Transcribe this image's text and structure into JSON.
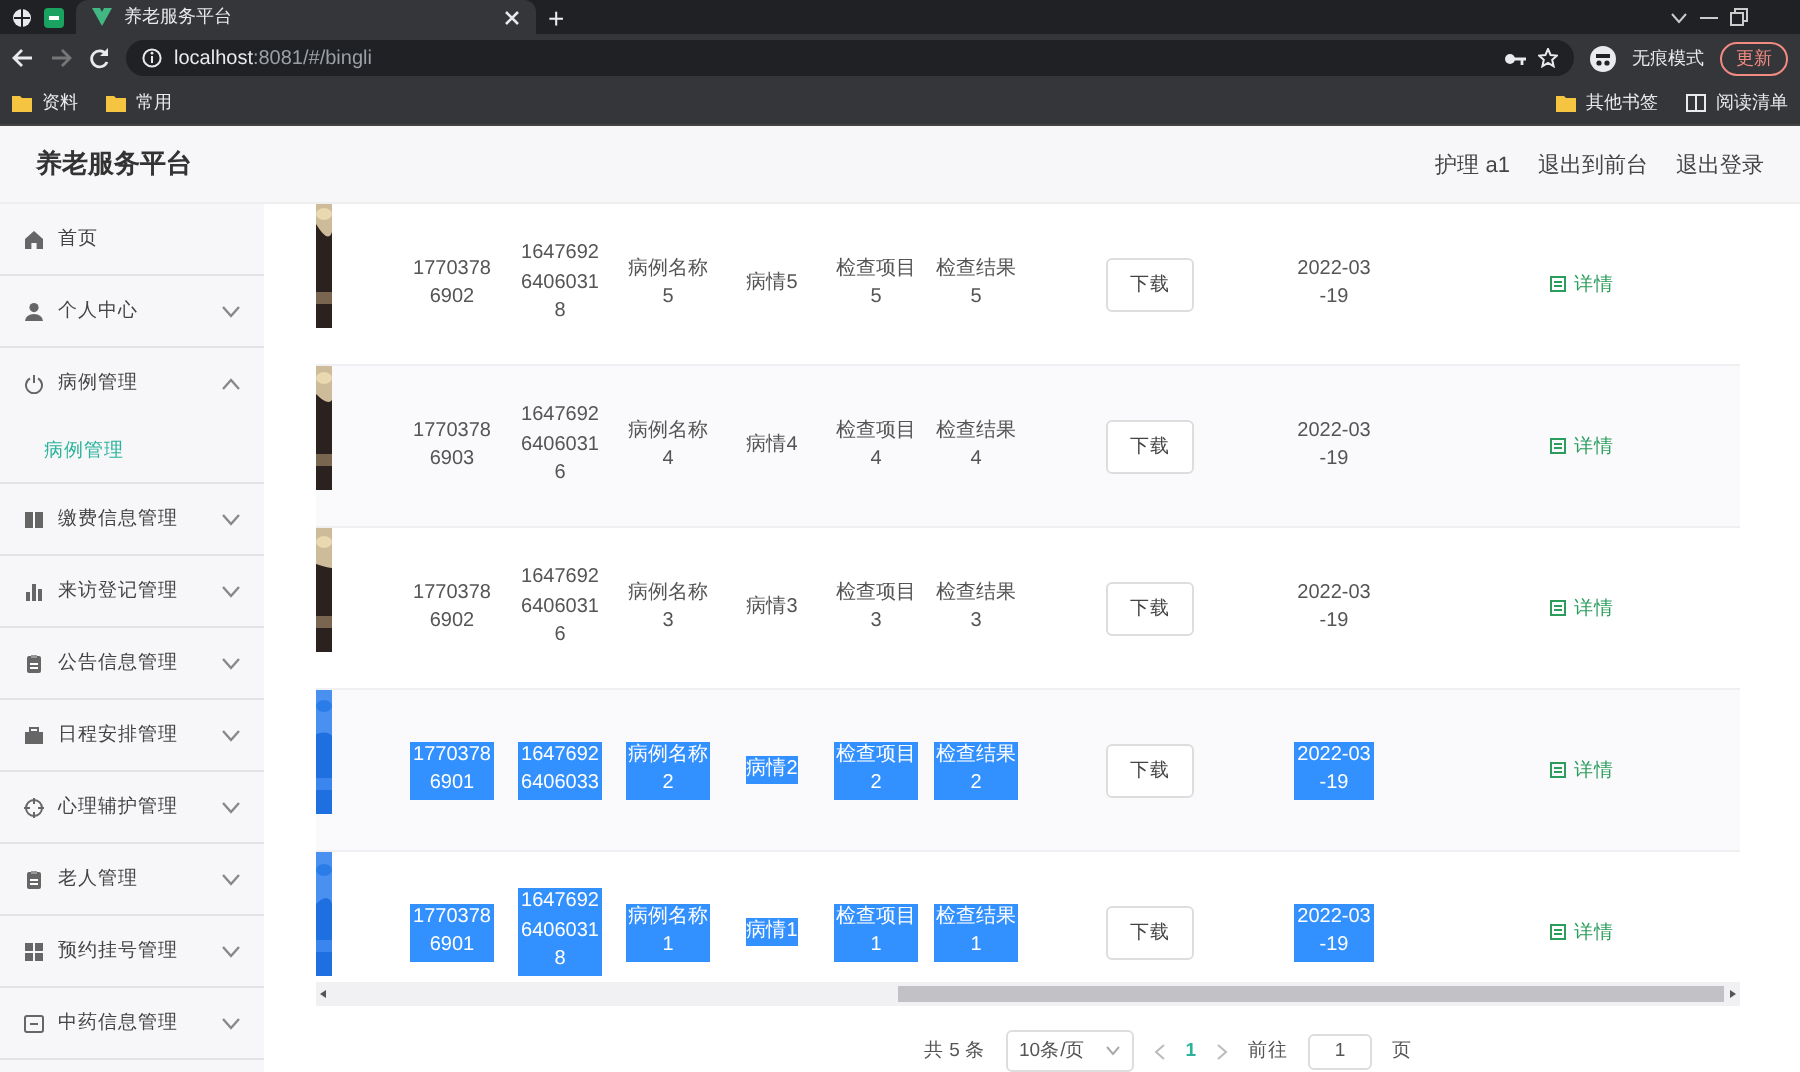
{
  "browser": {
    "tab_title": "养老服务平台",
    "new_tab": "+",
    "url_host": "localhost",
    "url_path": ":8081/#/bingli",
    "incognito": "无痕模式",
    "update": "更新",
    "bookmarks": [
      {
        "label": "资料"
      },
      {
        "label": "常用"
      }
    ],
    "bookmarks_right": [
      {
        "label": "其他书签",
        "kind": "folder"
      },
      {
        "label": "阅读清单",
        "kind": "list"
      }
    ]
  },
  "header": {
    "title": "养老服务平台",
    "links": [
      "护理 a1",
      "退出到前台",
      "退出登录"
    ]
  },
  "sidebar": {
    "items": [
      {
        "label": "首页",
        "kind": "link"
      },
      {
        "label": "个人中心",
        "kind": "menu",
        "expanded": false
      },
      {
        "label": "病例管理",
        "kind": "menu",
        "expanded": true,
        "children": [
          {
            "label": "病例管理",
            "selected": true
          }
        ]
      },
      {
        "label": "缴费信息管理",
        "kind": "menu",
        "expanded": false
      },
      {
        "label": "来访登记管理",
        "kind": "menu",
        "expanded": false
      },
      {
        "label": "公告信息管理",
        "kind": "menu",
        "expanded": false
      },
      {
        "label": "日程安排管理",
        "kind": "menu",
        "expanded": false
      },
      {
        "label": "心理辅护管理",
        "kind": "menu",
        "expanded": false
      },
      {
        "label": "老人管理",
        "kind": "menu",
        "expanded": false
      },
      {
        "label": "预约挂号管理",
        "kind": "menu",
        "expanded": false
      },
      {
        "label": "中药信息管理",
        "kind": "menu",
        "expanded": false
      }
    ]
  },
  "table": {
    "rows": [
      {
        "phone": "17703786902",
        "case_no": "164769264060318",
        "case_name": "病例名称5",
        "condition": "病情5",
        "exam_item": "检查项目5",
        "exam_result": "检查结果5",
        "download": "下载",
        "date": "2022-03-19",
        "detail": "详情",
        "highlighted": false
      },
      {
        "phone": "17703786903",
        "case_no": "164769264060316",
        "case_name": "病例名称4",
        "condition": "病情4",
        "exam_item": "检查项目4",
        "exam_result": "检查结果4",
        "download": "下载",
        "date": "2022-03-19",
        "detail": "详情",
        "highlighted": false
      },
      {
        "phone": "17703786902",
        "case_no": "164769264060316",
        "case_name": "病例名称3",
        "condition": "病情3",
        "exam_item": "检查项目3",
        "exam_result": "检查结果3",
        "download": "下载",
        "date": "2022-03-19",
        "detail": "详情",
        "highlighted": false
      },
      {
        "phone": "17703786901",
        "case_no": "16476926406033",
        "case_name": "病例名称2",
        "condition": "病情2",
        "exam_item": "检查项目2",
        "exam_result": "检查结果2",
        "download": "下载",
        "date": "2022-03-19",
        "detail": "详情",
        "highlighted": true
      },
      {
        "phone": "17703786901",
        "case_no": "164769264060318",
        "case_name": "病例名称1",
        "condition": "病情1",
        "exam_item": "检查项目1",
        "exam_result": "检查结果1",
        "download": "下载",
        "date": "2022-03-19",
        "detail": "详情",
        "highlighted": true
      }
    ]
  },
  "pagination": {
    "total": "共 5 条",
    "page_size": "10条/页",
    "pages": [
      {
        "label": "1",
        "selected": true
      }
    ],
    "goto_label": "前往",
    "goto_value": "1",
    "goto_suffix": "页"
  }
}
